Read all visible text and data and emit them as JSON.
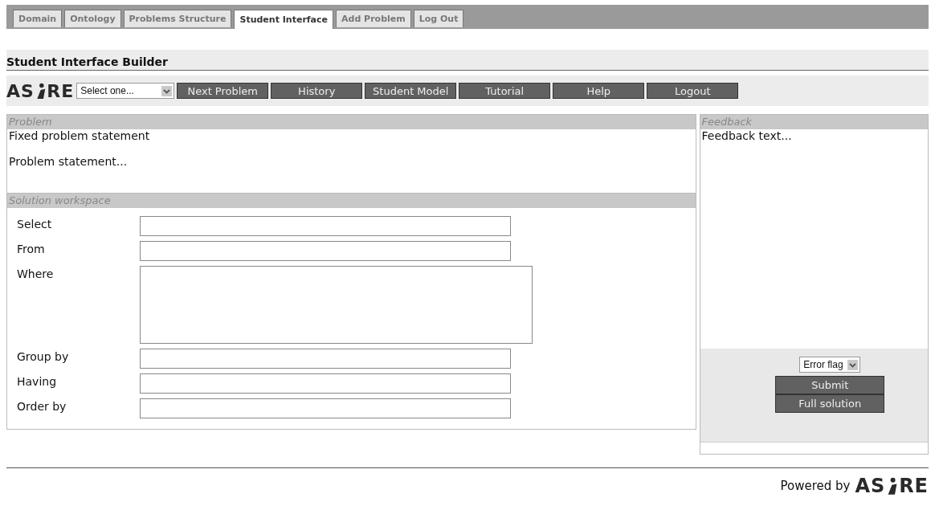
{
  "tabs": [
    {
      "label": "Domain",
      "selected": false
    },
    {
      "label": "Ontology",
      "selected": false
    },
    {
      "label": "Problems Structure",
      "selected": false
    },
    {
      "label": "Student Interface",
      "selected": true
    },
    {
      "label": "Add Problem",
      "selected": false
    },
    {
      "label": "Log Out",
      "selected": false
    }
  ],
  "page_title": "Student Interface Builder",
  "toolbar": {
    "logo": {
      "left": "AS",
      "right": "RE"
    },
    "select": {
      "value": "Select one..."
    },
    "buttons": [
      "Next Problem",
      "History",
      "Student Model",
      "Tutorial",
      "Help",
      "Logout"
    ]
  },
  "problem": {
    "title": "Problem",
    "fixed": "Fixed problem statement",
    "statement": "Problem statement..."
  },
  "workspace": {
    "title": "Solution workspace",
    "fields": [
      {
        "label": "Select",
        "kind": "line"
      },
      {
        "label": "From",
        "kind": "line"
      },
      {
        "label": "Where",
        "kind": "area"
      },
      {
        "label": "Group by",
        "kind": "line"
      },
      {
        "label": "Having",
        "kind": "line"
      },
      {
        "label": "Order by",
        "kind": "line"
      }
    ]
  },
  "feedback": {
    "title": "Feedback",
    "text": "Feedback text...",
    "error_select": "Error flag",
    "buttons": [
      "Submit",
      "Full solution"
    ]
  },
  "footer": {
    "label": "Powered by",
    "logo": {
      "left": "AS",
      "right": "RE"
    }
  }
}
